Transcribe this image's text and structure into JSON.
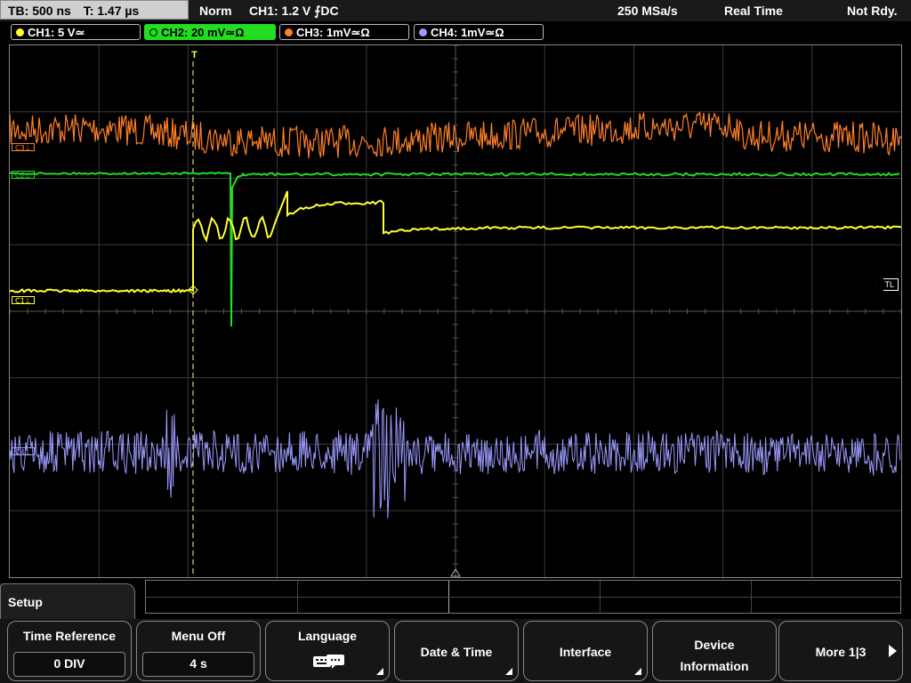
{
  "topbar": {
    "timebase": "TB: 500 ns",
    "trigger_time": "T: 1.47 µs",
    "trigger_mode": "Norm",
    "trigger_info": "CH1: 1.2 V ⨍DC",
    "sample_rate": "250 MSa/s",
    "acq_mode": "Real Time",
    "status": "Not Rdy."
  },
  "channels": [
    {
      "label": "CH1: 5 V≃",
      "color": "#ffff33",
      "active": false
    },
    {
      "label": "CH2: 20 mV≃Ω",
      "color": "#22dd22",
      "active": true
    },
    {
      "label": "CH3: 1mV≃Ω",
      "color": "#ff7f27",
      "active": false
    },
    {
      "label": "CH4: 1mV≃Ω",
      "color": "#9a9aff",
      "active": false
    }
  ],
  "markers": {
    "c3": "C3⊥",
    "c2": "C2⊥",
    "c1": "C1⊥",
    "c4": "C4⊥",
    "trigger_level": "TL",
    "trigger_pos": "T"
  },
  "colors": {
    "ch1": "#ffff33",
    "ch2": "#22dd22",
    "ch3": "#ff7f27",
    "ch4": "#9a9aff",
    "grid": "#3a3a3a"
  },
  "menu": {
    "title": "Setup",
    "softkeys": [
      {
        "label": "Time Reference",
        "value": "0 DIV"
      },
      {
        "label": "Menu Off",
        "value": "4 s"
      },
      {
        "label": "Language",
        "icon": "keyboard-icon"
      },
      {
        "label": "Date & Time"
      },
      {
        "label": "Interface"
      },
      {
        "label": "Device Information"
      },
      {
        "label": "More 1|3"
      }
    ]
  }
}
